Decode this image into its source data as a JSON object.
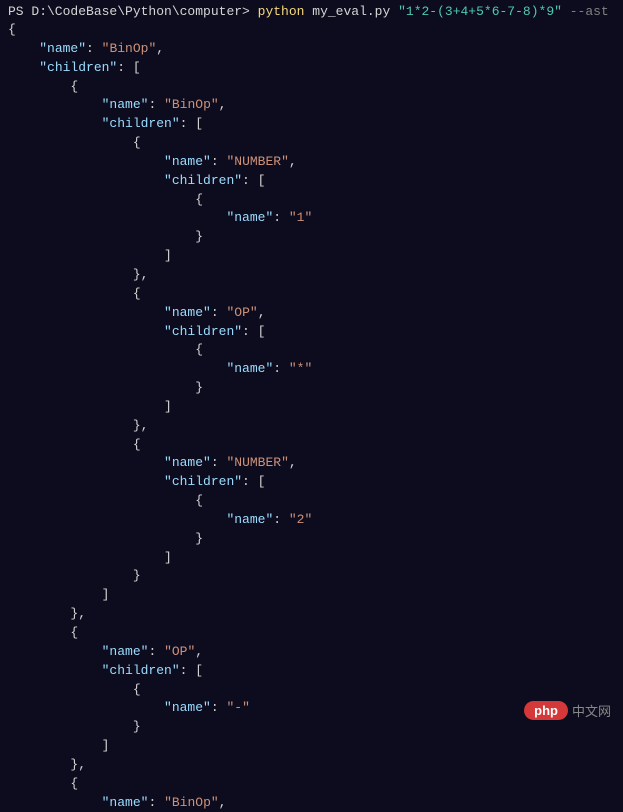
{
  "prompt": {
    "prefix": "PS ",
    "path": "D:\\CodeBase\\Python\\computer",
    "separator": "> ",
    "command": "python",
    "script": " my_eval.py ",
    "arg": "\"1*2-(3+4+5*6-7-8)*9\"",
    "flag": " --ast"
  },
  "json_lines": [
    "{",
    "    \"name\": \"BinOp\",",
    "    \"children\": [",
    "        {",
    "            \"name\": \"BinOp\",",
    "            \"children\": [",
    "                {",
    "                    \"name\": \"NUMBER\",",
    "                    \"children\": [",
    "                        {",
    "                            \"name\": \"1\"",
    "                        }",
    "                    ]",
    "                },",
    "                {",
    "                    \"name\": \"OP\",",
    "                    \"children\": [",
    "                        {",
    "                            \"name\": \"*\"",
    "                        }",
    "                    ]",
    "                },",
    "                {",
    "                    \"name\": \"NUMBER\",",
    "                    \"children\": [",
    "                        {",
    "                            \"name\": \"2\"",
    "                        }",
    "                    ]",
    "                }",
    "            ]",
    "        },",
    "        {",
    "            \"name\": \"OP\",",
    "            \"children\": [",
    "                {",
    "                    \"name\": \"-\"",
    "                }",
    "            ]",
    "        },",
    "        {",
    "            \"name\": \"BinOp\","
  ],
  "watermark": {
    "badge": "php",
    "text": "中文网"
  }
}
